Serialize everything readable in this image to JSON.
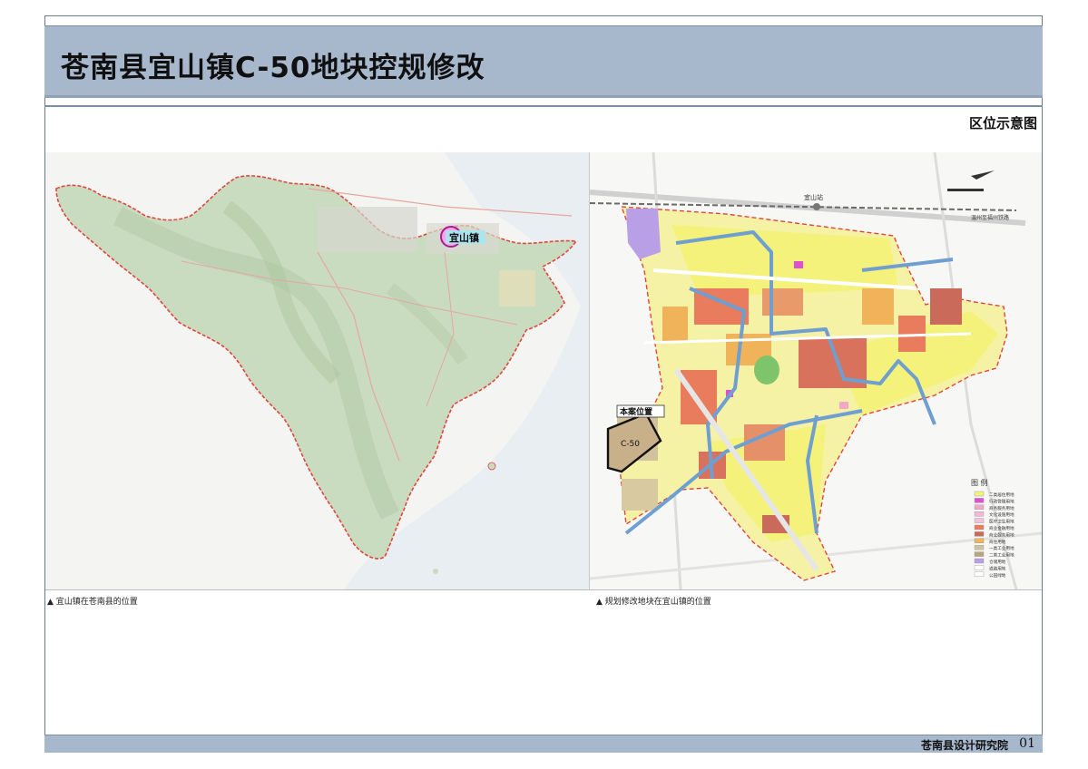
{
  "header": {
    "title": "苍南县宜山镇C-50地块控规修改",
    "section_label": "区位示意图"
  },
  "left_map": {
    "town_label": "宜山镇",
    "caption": "▲ 宜山镇在苍南县的位置"
  },
  "right_map": {
    "site_label": "本案位置",
    "parcel_label": "C-50",
    "station_label": "宜山站",
    "railway_label": "温州至福州铁路",
    "caption": "▲ 规划修改地块在宜山镇的位置",
    "legend": {
      "title": "图 例",
      "items": [
        {
          "label": "二类居住用地",
          "color": "#f4f27a"
        },
        {
          "label": "行政管理用地",
          "color": "#e04fd0"
        },
        {
          "label": "商务服务用地",
          "color": "#f2a6c8"
        },
        {
          "label": "文化设施用地",
          "color": "#f7b6d6"
        },
        {
          "label": "医疗卫生用地",
          "color": "#f3c2d8"
        },
        {
          "label": "商业金融用地",
          "color": "#e87c5c"
        },
        {
          "label": "商业服务用地",
          "color": "#c96a5a"
        },
        {
          "label": "商住用地",
          "color": "#f0b35a"
        },
        {
          "label": "一类工业用地",
          "color": "#cfc29c"
        },
        {
          "label": "二类工业用地",
          "color": "#b9a57c"
        },
        {
          "label": "仓储用地",
          "color": "#b9a0e6"
        },
        {
          "label": "道路用地",
          "color": "#ffffff"
        },
        {
          "label": "公园绿地",
          "color": "#ffffff"
        }
      ]
    }
  },
  "footer": {
    "org": "苍南县设计研究院",
    "page": "01"
  },
  "colors": {
    "band": "#a7b8cc",
    "county_fill": "#c9dcc0",
    "county_border": "#e0463b",
    "residential": "#f4f27a",
    "commercial": "#e87c5c",
    "water": "#6f9ed1"
  }
}
